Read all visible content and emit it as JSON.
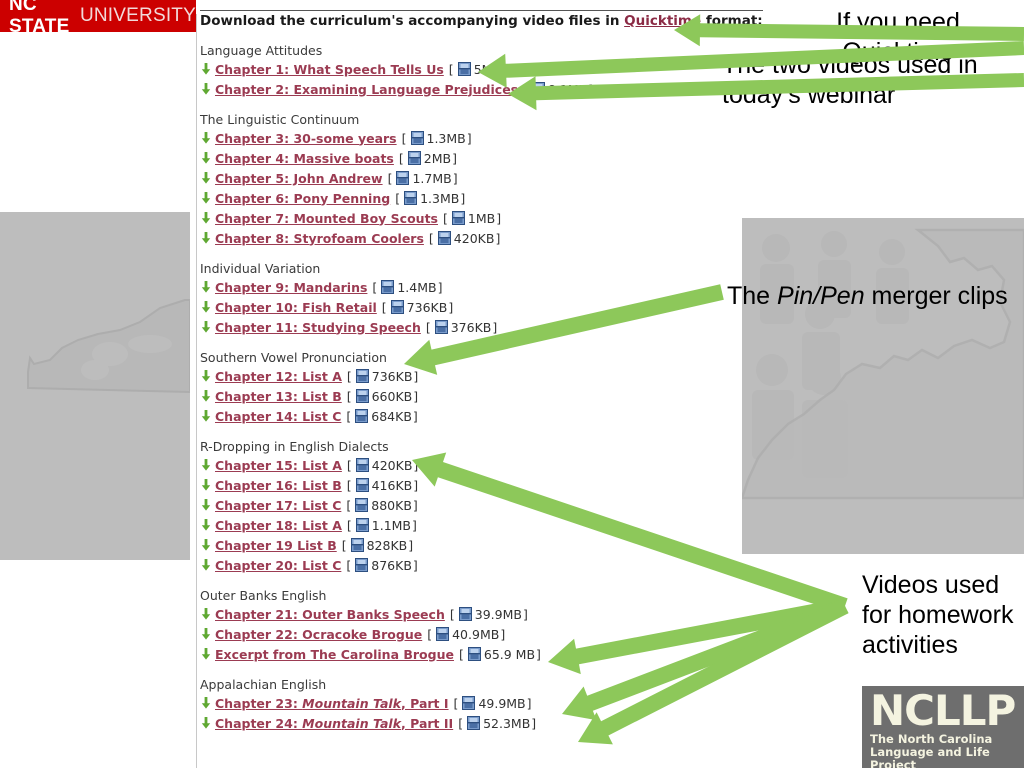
{
  "branding": {
    "ncsu_bold": "NC STATE",
    "ncsu_light": "UNIVERSITY",
    "ncllp_acronym": "NCLLP",
    "ncllp_line1": "The North Carolina",
    "ncllp_line2": "Language and Life Project"
  },
  "page": {
    "heading_before_link": "Download the curriculum's accompanying video files in ",
    "heading_link": "Quicktime",
    "heading_after_link": " format:"
  },
  "sections": [
    {
      "title": "Language Attitudes",
      "items": [
        {
          "label": "Chapter 1: What Speech Tells Us",
          "size": "5MB"
        },
        {
          "label": "Chapter 2: Examining Language Prejudices",
          "size": "8.1MB"
        }
      ]
    },
    {
      "title": "The Linguistic Continuum",
      "items": [
        {
          "label": "Chapter 3: 30-some years",
          "size": "1.3MB"
        },
        {
          "label": "Chapter 4: Massive boats",
          "size": "2MB"
        },
        {
          "label": "Chapter 5: John Andrew",
          "size": "1.7MB"
        },
        {
          "label": "Chapter 6: Pony Penning",
          "size": "1.3MB"
        },
        {
          "label": "Chapter 7: Mounted Boy Scouts",
          "size": "1MB"
        },
        {
          "label": "Chapter 8: Styrofoam Coolers",
          "size": "420KB"
        }
      ]
    },
    {
      "title": "Individual Variation",
      "items": [
        {
          "label": "Chapter 9: Mandarins",
          "size": "1.4MB"
        },
        {
          "label": "Chapter 10: Fish Retail",
          "size": "736KB"
        },
        {
          "label": "Chapter 11: Studying Speech",
          "size": "376KB"
        }
      ]
    },
    {
      "title": "Southern Vowel Pronunciation",
      "items": [
        {
          "label": "Chapter 12: List A",
          "size": "736KB"
        },
        {
          "label": "Chapter 13: List B",
          "size": "660KB"
        },
        {
          "label": "Chapter 14: List C",
          "size": "684KB"
        }
      ]
    },
    {
      "title": "R-Dropping in English Dialects",
      "items": [
        {
          "label": "Chapter 15: List A",
          "size": "420KB"
        },
        {
          "label": "Chapter 16: List B",
          "size": "416KB"
        },
        {
          "label": "Chapter 17: List C",
          "size": "880KB"
        },
        {
          "label": "Chapter 18: List A",
          "size": "1.1MB"
        },
        {
          "label": "Chapter 19 List B",
          "size": "828KB"
        },
        {
          "label": "Chapter 20: List C",
          "size": "876KB"
        }
      ]
    },
    {
      "title": "Outer Banks English",
      "items": [
        {
          "label": "Chapter 21: Outer Banks Speech",
          "size": "39.9MB"
        },
        {
          "label": "Chapter 22: Ocracoke Brogue",
          "size": "40.9MB"
        },
        {
          "label": "Excerpt from The Carolina Brogue",
          "size": "65.9 MB"
        }
      ]
    },
    {
      "title": "Appalachian English",
      "items": [
        {
          "label_pre": "Chapter 23: ",
          "label_italic": "Mountain Talk",
          "label_post": ", Part I",
          "size": "49.9MB"
        },
        {
          "label_pre": "Chapter 24: ",
          "label_italic": "Mountain Talk",
          "label_post": ", Part II",
          "size": "52.3MB"
        }
      ]
    }
  ],
  "annotations": {
    "quicktime": "If you need Quicktime",
    "two_videos": "The two videos used in today’s webinar",
    "pinpen_pre": "The ",
    "pinpen_italic": "Pin/Pen",
    "pinpen_post": " merger clips",
    "homework": "Videos used for homework activities"
  },
  "colors": {
    "arrow_green": "#8DC85A",
    "ncsu_red": "#CC0000",
    "link_maroon": "#9B3B52",
    "bullet_green": "#5FA832"
  }
}
